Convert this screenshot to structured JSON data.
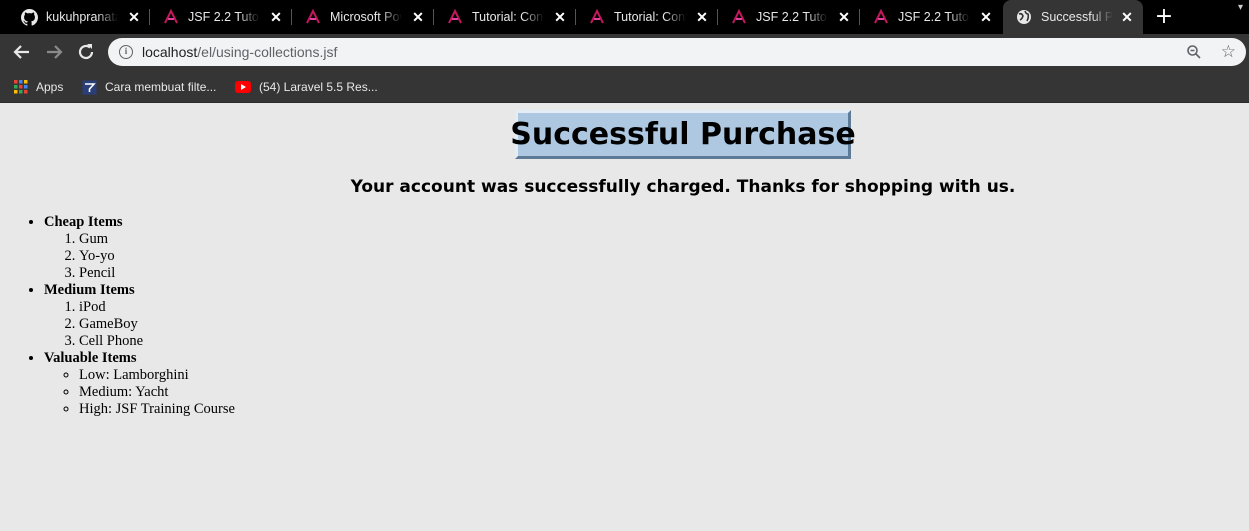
{
  "browser": {
    "tabs": [
      {
        "title": "kukuhpranata/",
        "icon": "github-icon"
      },
      {
        "title": "JSF 2.2 Tutorial",
        "icon": "jsf-icon"
      },
      {
        "title": "Microsoft Pow",
        "icon": "jsf-icon"
      },
      {
        "title": "Tutorial: Config",
        "icon": "jsf-icon"
      },
      {
        "title": "Tutorial: Config",
        "icon": "jsf-icon"
      },
      {
        "title": "JSF 2.2 Tutorial",
        "icon": "jsf-icon"
      },
      {
        "title": "JSF 2.2 Tutorial",
        "icon": "jsf-icon"
      },
      {
        "title": "Successful Pur",
        "icon": "globe-icon",
        "active": true
      }
    ],
    "url": {
      "host": "localhost",
      "path": "/el/using-collections.jsf"
    },
    "bookmarks": [
      {
        "label": "Apps",
        "icon": "apps-grid-icon"
      },
      {
        "label": "Cara membuat filte...",
        "icon": "bookmark-site-icon"
      },
      {
        "label": "(54) Laravel 5.5 Res...",
        "icon": "youtube-icon"
      }
    ],
    "colors": {
      "tab_strip": "#000000",
      "toolbar": "#353535",
      "accent_icon": "#c2185b"
    }
  },
  "page": {
    "title": "Successful Purchase",
    "subtitle": "Your account was successfully charged. Thanks for shopping with us.",
    "categories": [
      {
        "name": "Cheap Items",
        "list_type": "ordered",
        "items": [
          "Gum",
          "Yo-yo",
          "Pencil"
        ]
      },
      {
        "name": "Medium Items",
        "list_type": "ordered",
        "items": [
          "iPod",
          "GameBoy",
          "Cell Phone"
        ]
      },
      {
        "name": "Valuable Items",
        "list_type": "unordered",
        "items": [
          "Low: Lamborghini",
          "Medium: Yacht",
          "High: JSF Training Course"
        ]
      }
    ],
    "colors": {
      "background": "#e8e8e8",
      "heading_box": "#adc8e0"
    }
  }
}
